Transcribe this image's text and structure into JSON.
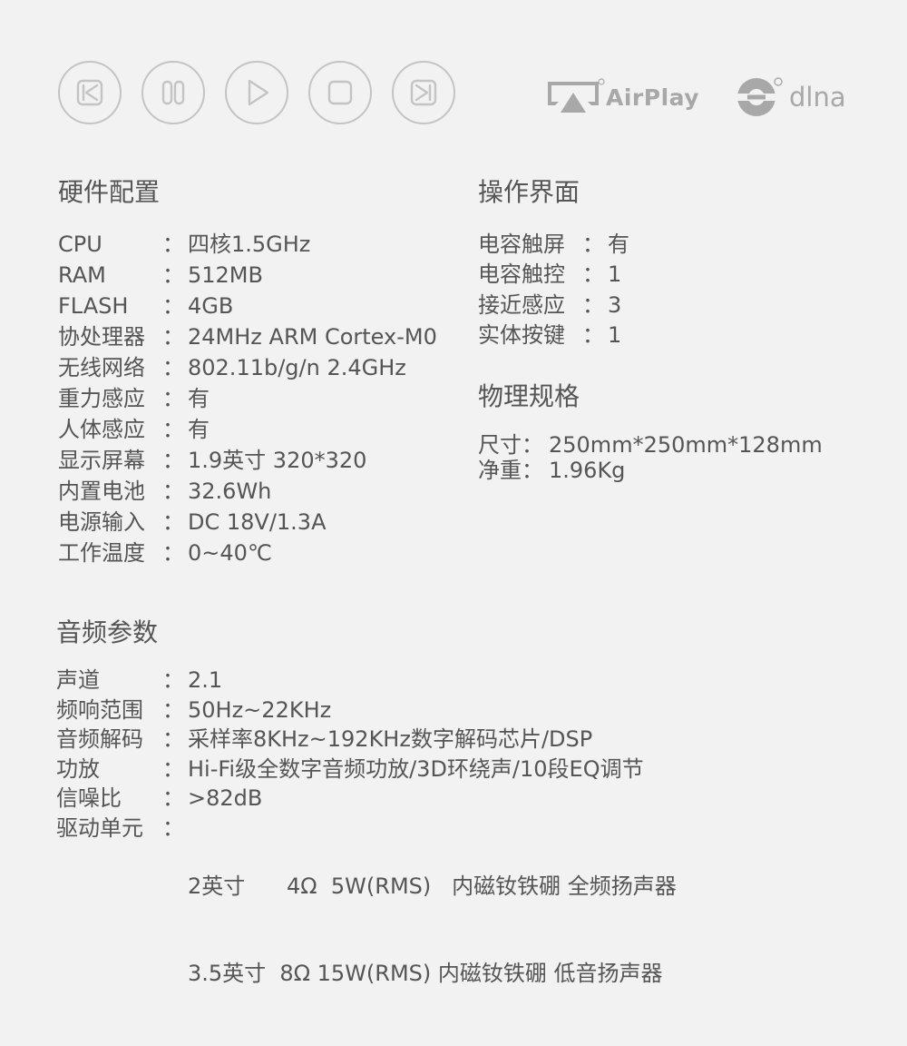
{
  "brands": {
    "airplay": "AirPlay",
    "dlna": "dlna"
  },
  "controls": [
    {
      "name": "previous",
      "icon": "skip-previous-icon"
    },
    {
      "name": "pause",
      "icon": "pause-icon"
    },
    {
      "name": "play",
      "icon": "play-icon"
    },
    {
      "name": "stop",
      "icon": "stop-icon"
    },
    {
      "name": "next",
      "icon": "skip-next-icon"
    }
  ],
  "hardware": {
    "title": "硬件配置",
    "items": [
      {
        "label": "CPU",
        "sep": "：",
        "value": "四核1.5GHz"
      },
      {
        "label": "RAM",
        "sep": "：",
        "value": "512MB"
      },
      {
        "label": "FLASH",
        "sep": "：",
        "value": "4GB"
      },
      {
        "label": "协处理器",
        "sep": "：",
        "value": "24MHz ARM Cortex-M0"
      },
      {
        "label": "无线网络",
        "sep": "：",
        "value": "802.11b/g/n 2.4GHz"
      },
      {
        "label": "重力感应",
        "sep": "：",
        "value": "有"
      },
      {
        "label": "人体感应",
        "sep": "：",
        "value": "有"
      },
      {
        "label": "显示屏幕",
        "sep": "：",
        "value": "1.9英寸 320*320"
      },
      {
        "label": "内置电池",
        "sep": "：",
        "value": "32.6Wh"
      },
      {
        "label": "电源输入",
        "sep": "：",
        "value": "DC 18V/1.3A"
      },
      {
        "label": "工作温度",
        "sep": "：",
        "value": "0~40℃"
      }
    ]
  },
  "interface": {
    "title": "操作界面",
    "items": [
      {
        "label": "电容触屏",
        "sep": "：",
        "value": "有"
      },
      {
        "label": "电容触控",
        "sep": "：",
        "value": "1"
      },
      {
        "label": "接近感应",
        "sep": "：",
        "value": "3"
      },
      {
        "label": "实体按键",
        "sep": "：",
        "value": "1"
      }
    ]
  },
  "physical": {
    "title": "物理规格",
    "items": [
      {
        "label": "尺寸：",
        "value": "250mm*250mm*128mm"
      },
      {
        "label": "净重：",
        "value": "1.96Kg"
      }
    ]
  },
  "audio": {
    "title": "音频参数",
    "items": [
      {
        "label": "声道",
        "sep": "：",
        "value": "2.1"
      },
      {
        "label": "频响范围",
        "sep": "：",
        "value": "50Hz~22KHz"
      },
      {
        "label": "音频解码",
        "sep": "：",
        "value": "采样率8KHz~192KHz数字解码芯片/DSP"
      },
      {
        "label": "功放",
        "sep": "：",
        "value": "Hi-Fi级全数字音频功放/3D环绕声/10段EQ调节"
      },
      {
        "label": "信噪比",
        "sep": "：",
        "value": ">82dB"
      }
    ],
    "driver": {
      "label": "驱动单元",
      "sep": "：",
      "line1": "2英寸      4Ω  5W(RMS)   内磁钕铁硼 全频扬声器",
      "line2": "3.5英寸  8Ω 15W(RMS) 内磁钕铁硼 低音扬声器"
    }
  }
}
